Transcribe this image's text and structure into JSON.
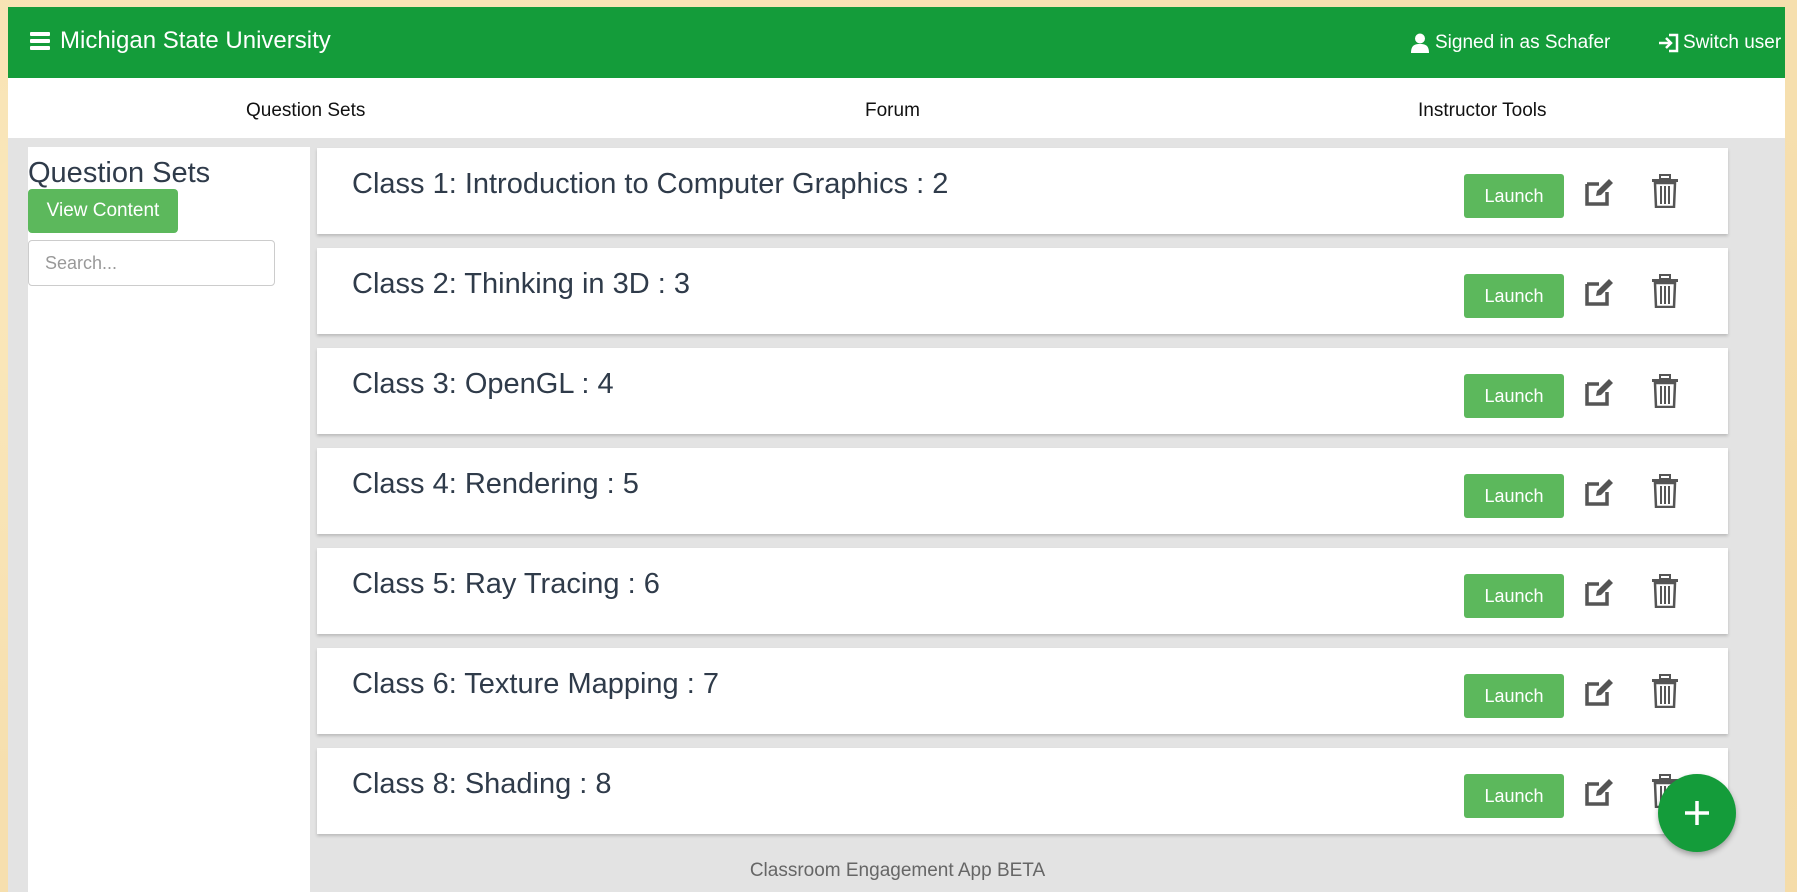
{
  "topbar": {
    "brand": "Michigan State University",
    "signed_in": "Signed in as Schafer",
    "switch_user": "Switch user"
  },
  "nav": [
    "Question Sets",
    "Forum",
    "Instructor Tools"
  ],
  "sidebar": {
    "title": "Question Sets",
    "view_content": "View Content",
    "search_placeholder": "Search..."
  },
  "sets": [
    {
      "title": "Class 1: Introduction to Computer Graphics : 2"
    },
    {
      "title": "Class 2: Thinking in 3D : 3"
    },
    {
      "title": "Class 3: OpenGL : 4"
    },
    {
      "title": "Class 4: Rendering : 5"
    },
    {
      "title": "Class 5: Ray Tracing : 6"
    },
    {
      "title": "Class 6: Texture Mapping : 7"
    },
    {
      "title": "Class 8: Shading : 8"
    }
  ],
  "launch_label": "Launch",
  "footer": "Classroom Engagement App BETA",
  "icons": {
    "menu": "hamburger-icon",
    "user": "user-icon",
    "signin": "sign-in-icon",
    "edit": "edit-icon",
    "delete": "trash-icon",
    "add": "plus-icon"
  },
  "colors": {
    "brand_green": "#149c3a",
    "button_green": "#5cb85c",
    "text_dark": "#2f3b4a"
  }
}
